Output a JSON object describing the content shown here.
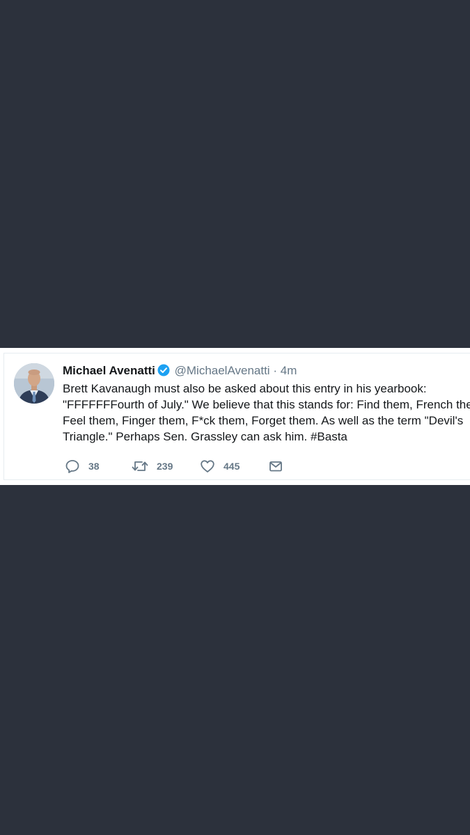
{
  "tweet": {
    "display_name": "Michael Avenatti",
    "verified": true,
    "handle": "@MichaelAvenatti",
    "separator": "·",
    "timestamp": "4m",
    "text_lines": [
      "Brett Kavanaugh must also be asked about this entry in his yearbook:",
      "\"FFFFFFFourth of July.\" We believe that this stands for: Find them, French them,",
      "Feel them, Finger them, F*ck them, Forget them. As well as the term \"Devil's",
      "Triangle.\" Perhaps Sen. Grassley can ask him. #Basta"
    ],
    "actions": {
      "reply_count": "38",
      "retweet_count": "239",
      "like_count": "445"
    }
  },
  "icons": {
    "reply": "reply-icon",
    "retweet": "retweet-icon",
    "like": "heart-icon",
    "dm": "envelope-icon",
    "verified": "verified-badge-icon"
  },
  "colors": {
    "background": "#2c313c",
    "card": "#ffffff",
    "name": "#14171a",
    "secondary": "#657786",
    "verified": "#1da1f2"
  }
}
